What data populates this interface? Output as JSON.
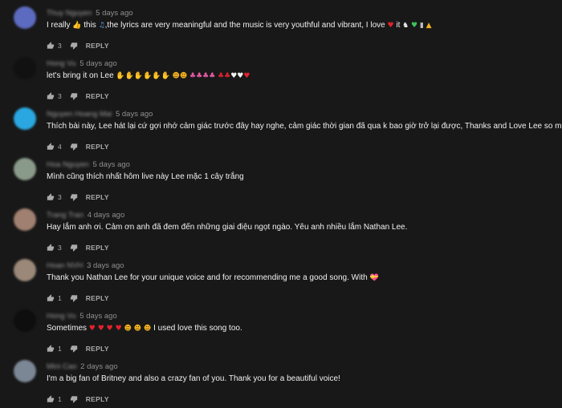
{
  "colors": {
    "background": "#181818",
    "text": "#f1f1f1",
    "secondary_text": "#aaaaaa"
  },
  "comments": [
    {
      "time": "5 days ago",
      "avatar_color": "#5c6bc0",
      "text_parts": [
        "I really",
        "this",
        ",the lyrics are very meaningful and the music is very youthful and vibrant, I love",
        "it"
      ],
      "likes": "3",
      "reply_label": "REPLY"
    },
    {
      "time": "5 days ago",
      "avatar_color": "#111111",
      "text_parts": [
        "let's bring it on Lee"
      ],
      "likes": "3",
      "reply_label": "REPLY"
    },
    {
      "time": "5 days ago",
      "avatar_color": "#2aa7e0",
      "text_parts": [
        "Thích bài này, Lee hát lại cứ gợi nhớ cảm giác trước đây hay nghe, cảm giác thời gian đã qua k bao giờ trở lại được, Thanks and Love Lee so much!"
      ],
      "likes": "4",
      "reply_label": "REPLY"
    },
    {
      "time": "5 days ago",
      "avatar_color": "#8a9a8a",
      "text_parts": [
        "Mình cũng thích nhất hôm live này Lee mặc 1 cây trắng"
      ],
      "likes": "3",
      "reply_label": "REPLY"
    },
    {
      "time": "4 days ago",
      "avatar_color": "#a08070",
      "text_parts": [
        "Hay lắm anh ơi. Cảm ơn anh đã đem đến những giai điệu ngọt ngào. Yêu anh nhiều lắm Nathan Lee."
      ],
      "likes": "3",
      "reply_label": "REPLY"
    },
    {
      "time": "3 days ago",
      "avatar_color": "#9b8878",
      "text_parts": [
        "Thank you Nathan Lee for your unique voice and for recommending me a good song. With"
      ],
      "likes": "1",
      "reply_label": "REPLY"
    },
    {
      "time": "5 days ago",
      "avatar_color": "#0e0e0e",
      "text_parts": [
        "Sometimes",
        "I used love this song too."
      ],
      "likes": "1",
      "reply_label": "REPLY"
    },
    {
      "time": "2 days ago",
      "avatar_color": "#7b8794",
      "text_parts": [
        "I'm a big fan of Britney and also a crazy fan of you. Thank you for a beautiful voice!"
      ],
      "likes": "1",
      "reply_label": "REPLY"
    }
  ]
}
